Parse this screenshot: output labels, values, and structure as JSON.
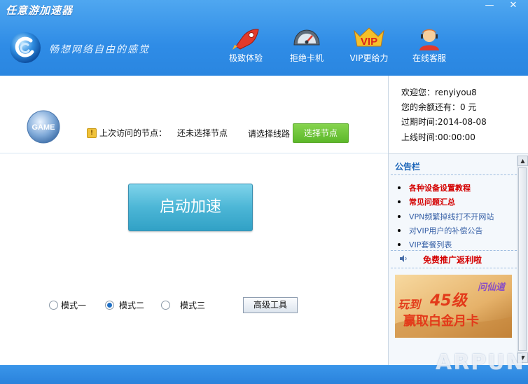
{
  "window": {
    "title": "任意游加速器",
    "minimize": "—",
    "close": "✕"
  },
  "header": {
    "slogan": "畅想网络自由的感觉",
    "nav": [
      {
        "label": "极致体验",
        "icon": "rocket-icon"
      },
      {
        "label": "拒绝卡机",
        "icon": "speedometer-icon"
      },
      {
        "label": "VIP更给力",
        "icon": "vip-icon"
      },
      {
        "label": "在线客服",
        "icon": "customer-service-icon"
      }
    ]
  },
  "node": {
    "game_badge": "GAME",
    "last_node_label": "上次访问的节点：",
    "last_node_value": "还未选择节点",
    "choose_line": "请选择线路",
    "select_button": "选择节点"
  },
  "main": {
    "start_button": "启动加速",
    "modes": [
      {
        "label": "模式一",
        "checked": false
      },
      {
        "label": "模式二",
        "checked": true
      },
      {
        "label": "模式三",
        "checked": false
      }
    ],
    "tools_button": "高级工具"
  },
  "account": {
    "welcome": "欢迎您：renyiyou8",
    "balance": "您的余额还有：0 元",
    "expire": "过期时间:2014-08-08",
    "online": "上线时间:00:00:00"
  },
  "notice": {
    "title": "公告栏",
    "items": [
      {
        "text": "各种设备设置教程",
        "style": "red"
      },
      {
        "text": "常见问题汇总",
        "style": "red"
      },
      {
        "text": "VPN频繁掉线打不开网站",
        "style": "blue"
      },
      {
        "text": "对VIP用户的补偿公告",
        "style": "blue"
      },
      {
        "text": "VIP套餐列表",
        "style": "blue"
      }
    ],
    "promo": "免费推广返利啦",
    "banner": {
      "line1": "玩到",
      "level": "45级",
      "line2": "赢取白金月卡",
      "game": "问仙道"
    }
  },
  "watermark": "ARPUN",
  "colors": {
    "header": "#3b95ea",
    "start_button": "#4cb6d6",
    "select_button": "#5cb82a",
    "notice_red": "#d40000"
  }
}
